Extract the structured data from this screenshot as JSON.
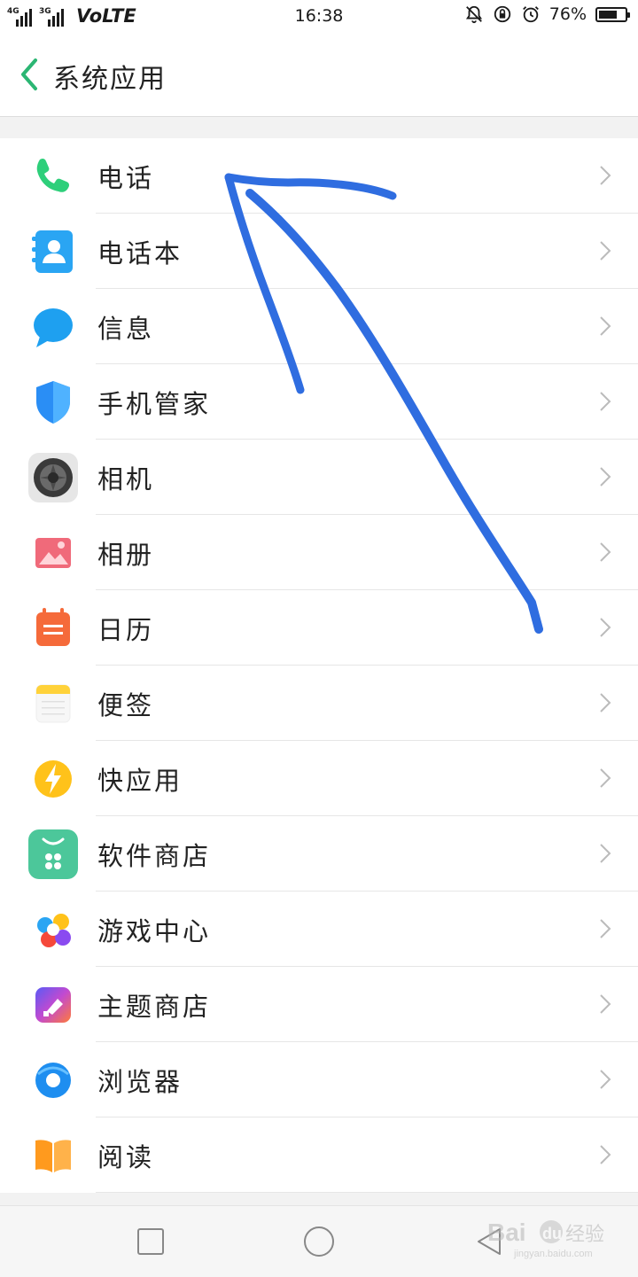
{
  "status_bar": {
    "signal_1_type": "4G",
    "signal_2_type": "3G",
    "volte": "VoLTE",
    "time": "16:38",
    "battery_percent": "76%",
    "battery_level": 0.76,
    "icons": [
      "bell-muted-icon",
      "rotation-lock-icon",
      "alarm-icon"
    ]
  },
  "header": {
    "title": "系统应用",
    "back_icon": "chevron-left-icon",
    "accent_color": "#2bb673"
  },
  "apps": [
    {
      "label": "电话",
      "icon": "phone-icon",
      "color": "#2ecf7a"
    },
    {
      "label": "电话本",
      "icon": "contacts-icon",
      "color": "#2aa5f3"
    },
    {
      "label": "信息",
      "icon": "message-icon",
      "color": "#1ea0f0"
    },
    {
      "label": "手机管家",
      "icon": "shield-icon",
      "color": "#2a8ef5"
    },
    {
      "label": "相机",
      "icon": "camera-icon",
      "color": "#555555"
    },
    {
      "label": "相册",
      "icon": "gallery-icon",
      "color": "#f06a7a"
    },
    {
      "label": "日历",
      "icon": "calendar-icon",
      "color": "#f56a3a"
    },
    {
      "label": "便签",
      "icon": "notes-icon",
      "color": "#ffd23a"
    },
    {
      "label": "快应用",
      "icon": "quick-app-icon",
      "color": "#ffc21a"
    },
    {
      "label": "软件商店",
      "icon": "app-store-icon",
      "color": "#4cc79a"
    },
    {
      "label": "游戏中心",
      "icon": "game-center-icon",
      "color": "#f5483a"
    },
    {
      "label": "主题商店",
      "icon": "theme-store-icon",
      "color": "#8a4af0"
    },
    {
      "label": "浏览器",
      "icon": "browser-icon",
      "color": "#1e8ef0"
    },
    {
      "label": "阅读",
      "icon": "reading-icon",
      "color": "#ff9a1e"
    }
  ],
  "nav_bar": {
    "buttons": [
      "recents-button",
      "home-button",
      "back-button"
    ]
  },
  "annotation": {
    "color": "#2f6de0",
    "description_icon": "hand-drawn-arrow"
  },
  "watermark": {
    "brand": "Baidu经验",
    "url": "jingyan.baidu.com"
  }
}
